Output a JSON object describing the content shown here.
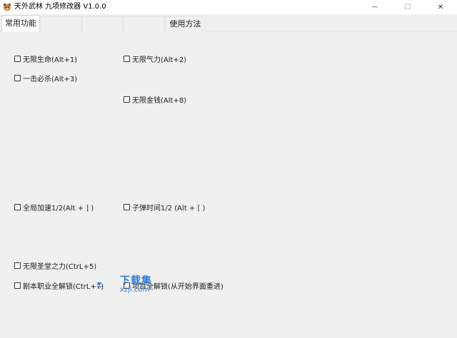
{
  "window": {
    "title": "天外武林 九项修改器  V1.0.0",
    "minimize_glyph": "—",
    "maximize_glyph": "☐",
    "close_glyph": "✕"
  },
  "tabs": [
    {
      "label": "常用功能",
      "active": true
    },
    {
      "label": ""
    },
    {
      "label": ""
    },
    {
      "label": ""
    },
    {
      "label": "使用方法"
    }
  ],
  "options": {
    "infinite_life": "无限生命(Alt+1)",
    "infinite_energy": "无限气力(Alt+2)",
    "one_hit_kill": "一击必杀(Alt+3)",
    "infinite_money": "无限金钱(Alt+8)",
    "global_speed": "全局加速1/2(Alt + ] )",
    "bullet_time": "子弹时间1/2 (Alt + [ )",
    "infinite_holy": "无限圣堂之力(CtrL+5)",
    "unlock_classes": "剧本职业全解锁(CtrL+7)",
    "unlock_levels": "项目全解锁(从开始界面重进)"
  },
  "watermark": {
    "cn": "下载集",
    "en": "xzji.com"
  },
  "colors": {
    "watermark": "#2f7fd6",
    "background": "#f0f0f0"
  }
}
